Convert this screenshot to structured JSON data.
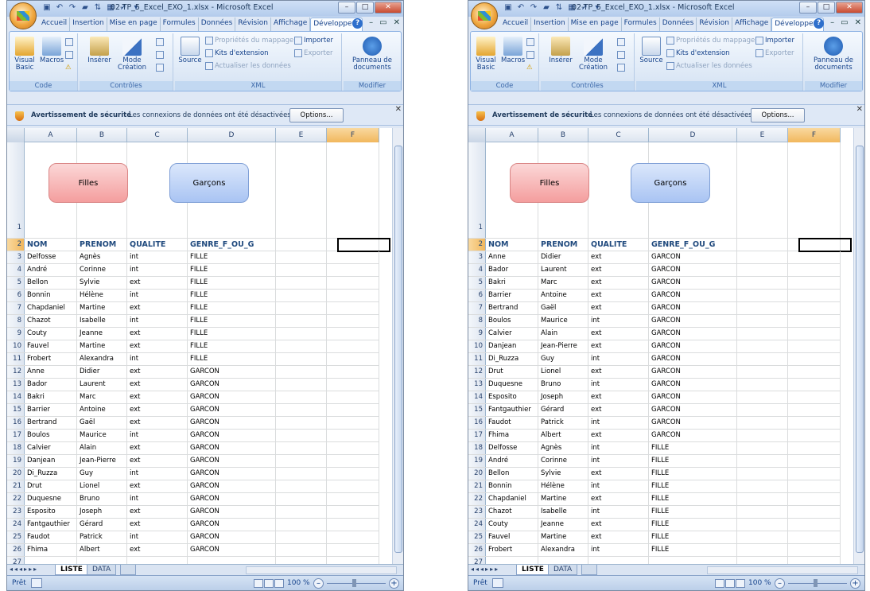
{
  "windows": [
    {
      "title": "02-TP_5_Excel_EXO_1.xlsx - Microsoft Excel",
      "tabs": [
        "Accueil",
        "Insertion",
        "Mise en page",
        "Formules",
        "Données",
        "Révision",
        "Affichage",
        "Développeur"
      ],
      "ribbon": {
        "code": {
          "label": "Code",
          "visual_basic": "Visual Basic",
          "macros": "Macros"
        },
        "controles": {
          "label": "Contrôles",
          "inserer": "Insérer",
          "mode_creation": "Mode Création"
        },
        "xml": {
          "label": "XML",
          "source": "Source",
          "proprietes": "Propriétés du mappage",
          "kits": "Kits d'extension",
          "actualiser": "Actualiser les données",
          "importer": "Importer",
          "exporter": "Exporter"
        },
        "modifier": {
          "label": "Modifier",
          "panneau": "Panneau de documents"
        }
      },
      "security": {
        "title": "Avertissement de sécurité",
        "message": "Les connexions de données ont été désactivées",
        "options_label": "Options..."
      },
      "columns": [
        "A",
        "B",
        "C",
        "D",
        "E",
        "F"
      ],
      "shapes": {
        "filles": "Filles",
        "garcons": "Garçons"
      },
      "header_row": [
        "NOM",
        "PRENOM",
        "QUALITE",
        "GENRE_F_OU_G"
      ],
      "rows": [
        [
          "Delfosse",
          "Agnès",
          "int",
          "FILLE"
        ],
        [
          "André",
          "Corinne",
          "int",
          "FILLE"
        ],
        [
          "Bellon",
          "Sylvie",
          "ext",
          "FILLE"
        ],
        [
          "Bonnin",
          "Hélène",
          "int",
          "FILLE"
        ],
        [
          "Chapdaniel",
          "Martine",
          "ext",
          "FILLE"
        ],
        [
          "Chazot",
          "Isabelle",
          "int",
          "FILLE"
        ],
        [
          "Couty",
          "Jeanne",
          "ext",
          "FILLE"
        ],
        [
          "Fauvel",
          "Martine",
          "ext",
          "FILLE"
        ],
        [
          "Frobert",
          "Alexandra",
          "int",
          "FILLE"
        ],
        [
          "Anne",
          "Didier",
          "ext",
          "GARCON"
        ],
        [
          "Bador",
          "Laurent",
          "ext",
          "GARCON"
        ],
        [
          "Bakri",
          "Marc",
          "ext",
          "GARCON"
        ],
        [
          "Barrier",
          "Antoine",
          "ext",
          "GARCON"
        ],
        [
          "Bertrand",
          "Gaël",
          "ext",
          "GARCON"
        ],
        [
          "Boulos",
          "Maurice",
          "int",
          "GARCON"
        ],
        [
          "Calvier",
          "Alain",
          "ext",
          "GARCON"
        ],
        [
          "Danjean",
          "Jean-Pierre",
          "ext",
          "GARCON"
        ],
        [
          "Di_Ruzza",
          "Guy",
          "int",
          "GARCON"
        ],
        [
          "Drut",
          "Lionel",
          "ext",
          "GARCON"
        ],
        [
          "Duquesne",
          "Bruno",
          "int",
          "GARCON"
        ],
        [
          "Esposito",
          "Joseph",
          "ext",
          "GARCON"
        ],
        [
          "Fantgauthier",
          "Gérard",
          "ext",
          "GARCON"
        ],
        [
          "Faudot",
          "Patrick",
          "int",
          "GARCON"
        ],
        [
          "Fhima",
          "Albert",
          "ext",
          "GARCON"
        ]
      ],
      "sheet_tabs": [
        "LISTE",
        "DATA"
      ],
      "status": {
        "ready": "Prêt",
        "zoom": "100 %"
      }
    },
    {
      "title": "02-TP_5_Excel_EXO_1.xlsx - Microsoft Excel",
      "tabs": [
        "Accueil",
        "Insertion",
        "Mise en page",
        "Formules",
        "Données",
        "Révision",
        "Affichage",
        "Développeur"
      ],
      "ribbon": {
        "code": {
          "label": "Code",
          "visual_basic": "Visual Basic",
          "macros": "Macros"
        },
        "controles": {
          "label": "Contrôles",
          "inserer": "Insérer",
          "mode_creation": "Mode Création"
        },
        "xml": {
          "label": "XML",
          "source": "Source",
          "proprietes": "Propriétés du mappage",
          "kits": "Kits d'extension",
          "actualiser": "Actualiser les données",
          "importer": "Importer",
          "exporter": "Exporter"
        },
        "modifier": {
          "label": "Modifier",
          "panneau": "Panneau de documents"
        }
      },
      "security": {
        "title": "Avertissement de sécurité",
        "message": "Les connexions de données ont été désactivées",
        "options_label": "Options..."
      },
      "columns": [
        "A",
        "B",
        "C",
        "D",
        "E",
        "F"
      ],
      "shapes": {
        "filles": "Filles",
        "garcons": "Garçons"
      },
      "header_row": [
        "NOM",
        "PRENOM",
        "QUALITE",
        "GENRE_F_OU_G"
      ],
      "rows": [
        [
          "Anne",
          "Didier",
          "ext",
          "GARCON"
        ],
        [
          "Bador",
          "Laurent",
          "ext",
          "GARCON"
        ],
        [
          "Bakri",
          "Marc",
          "ext",
          "GARCON"
        ],
        [
          "Barrier",
          "Antoine",
          "ext",
          "GARCON"
        ],
        [
          "Bertrand",
          "Gaël",
          "ext",
          "GARCON"
        ],
        [
          "Boulos",
          "Maurice",
          "int",
          "GARCON"
        ],
        [
          "Calvier",
          "Alain",
          "ext",
          "GARCON"
        ],
        [
          "Danjean",
          "Jean-Pierre",
          "ext",
          "GARCON"
        ],
        [
          "Di_Ruzza",
          "Guy",
          "int",
          "GARCON"
        ],
        [
          "Drut",
          "Lionel",
          "ext",
          "GARCON"
        ],
        [
          "Duquesne",
          "Bruno",
          "int",
          "GARCON"
        ],
        [
          "Esposito",
          "Joseph",
          "ext",
          "GARCON"
        ],
        [
          "Fantgauthier",
          "Gérard",
          "ext",
          "GARCON"
        ],
        [
          "Faudot",
          "Patrick",
          "int",
          "GARCON"
        ],
        [
          "Fhima",
          "Albert",
          "ext",
          "GARCON"
        ],
        [
          "Delfosse",
          "Agnès",
          "int",
          "FILLE"
        ],
        [
          "André",
          "Corinne",
          "int",
          "FILLE"
        ],
        [
          "Bellon",
          "Sylvie",
          "ext",
          "FILLE"
        ],
        [
          "Bonnin",
          "Hélène",
          "int",
          "FILLE"
        ],
        [
          "Chapdaniel",
          "Martine",
          "ext",
          "FILLE"
        ],
        [
          "Chazot",
          "Isabelle",
          "int",
          "FILLE"
        ],
        [
          "Couty",
          "Jeanne",
          "ext",
          "FILLE"
        ],
        [
          "Fauvel",
          "Martine",
          "ext",
          "FILLE"
        ],
        [
          "Frobert",
          "Alexandra",
          "int",
          "FILLE"
        ]
      ],
      "sheet_tabs": [
        "LISTE",
        "DATA"
      ],
      "status": {
        "ready": "Prêt",
        "zoom": "100 %"
      }
    }
  ]
}
